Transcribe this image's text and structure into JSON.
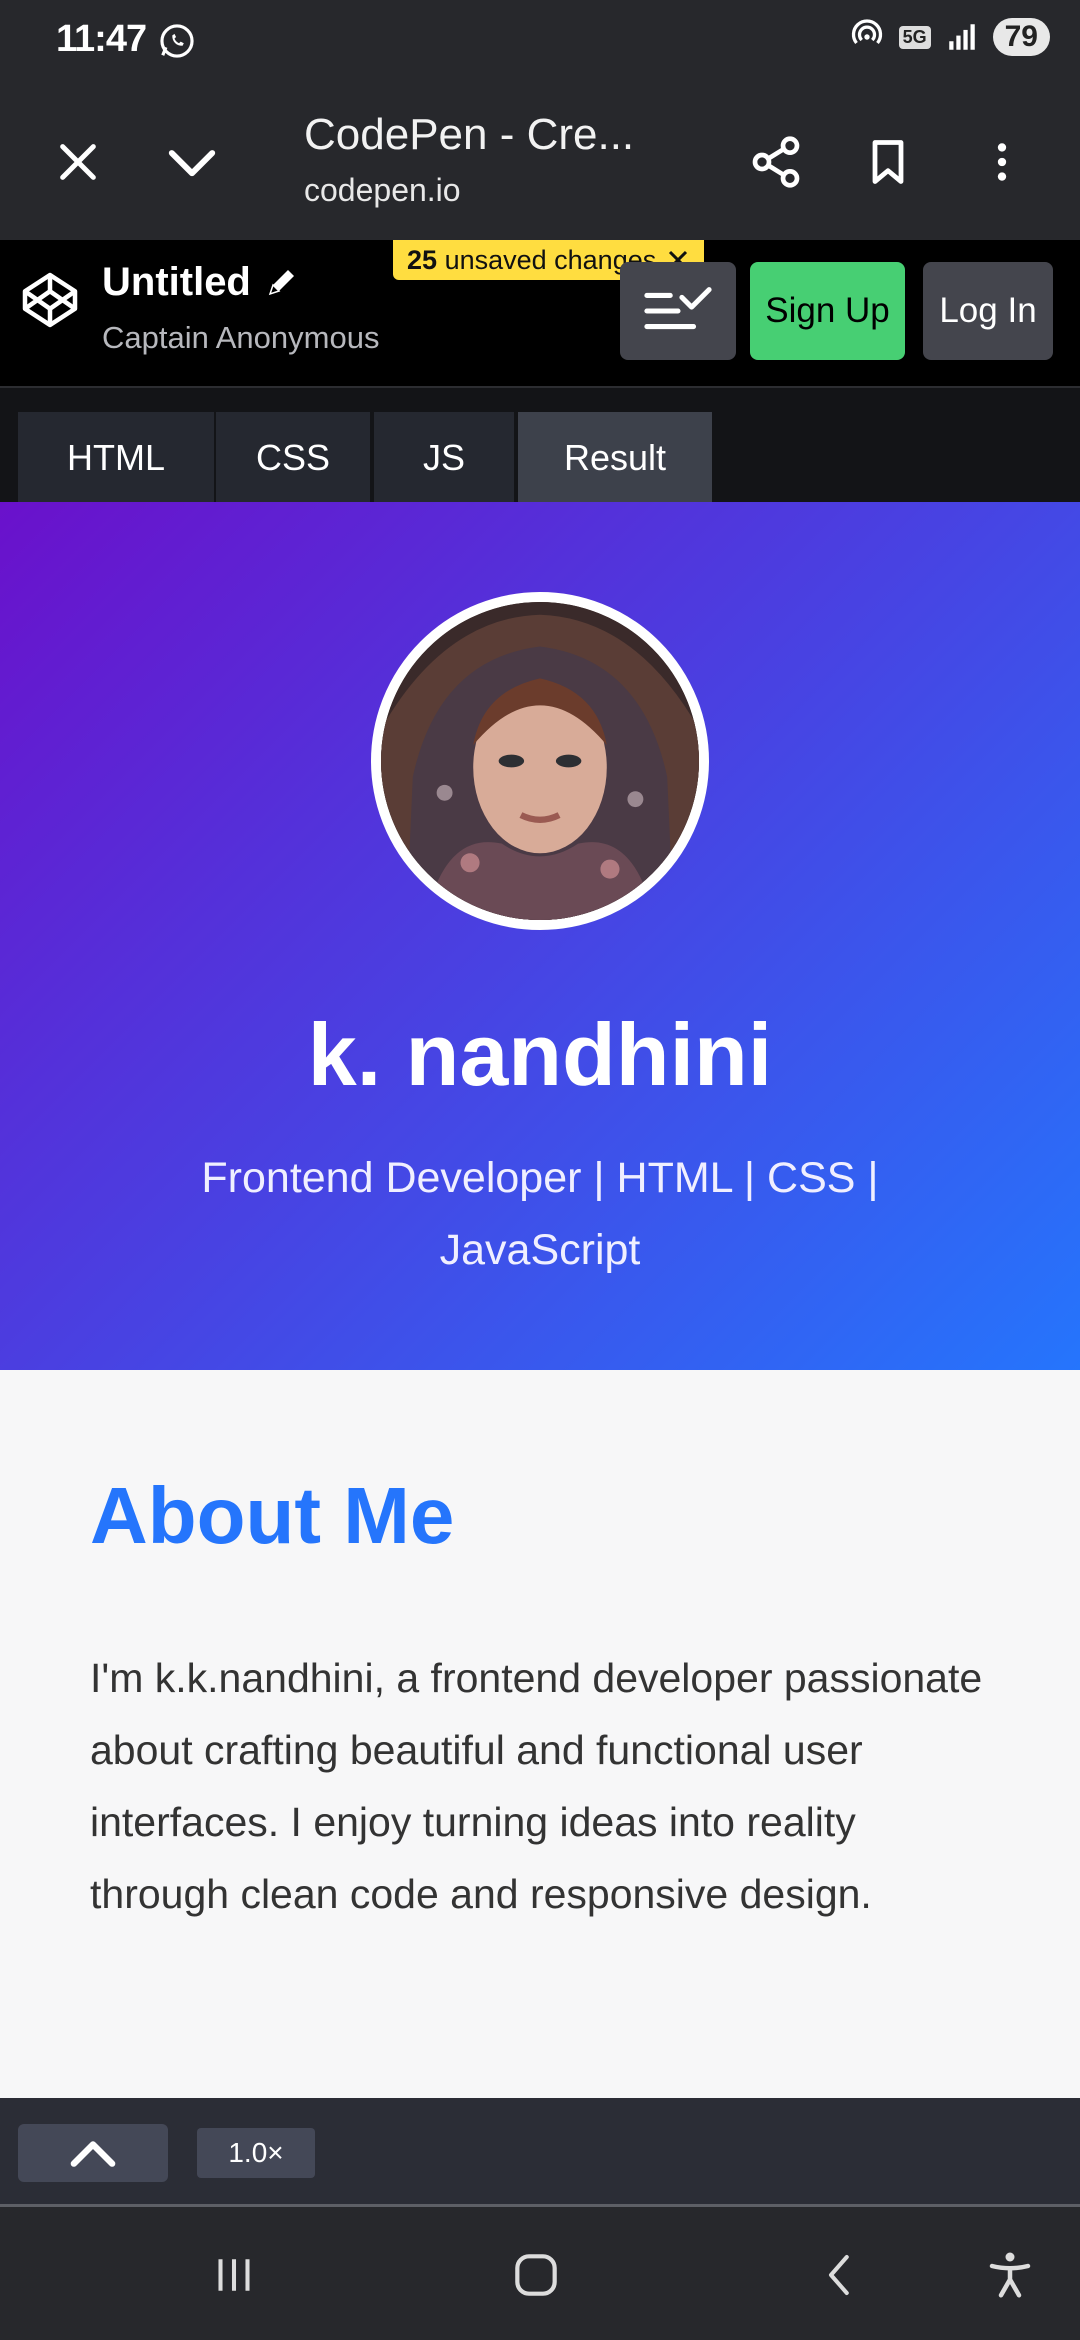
{
  "status_bar": {
    "time": "11:47",
    "network": "5G",
    "battery": "79"
  },
  "browser": {
    "page_title": "CodePen - Cre...",
    "url": "codepen.io",
    "icons": [
      "close-icon",
      "chevron-down-icon",
      "share-icon",
      "bookmark-icon",
      "more-vert-icon"
    ]
  },
  "codepen": {
    "pen_title": "Untitled",
    "author": "Captain Anonymous",
    "unsaved_count": "25",
    "unsaved_label": "unsaved changes",
    "signup_label": "Sign Up",
    "login_label": "Log In",
    "tabs": [
      "HTML",
      "CSS",
      "JS",
      "Result"
    ],
    "active_tab": "Result"
  },
  "result": {
    "name": "k. nandhini",
    "subtitle": "Frontend Developer | HTML | CSS | JavaScript",
    "about_heading": "About Me",
    "about_text": "I'm k.k.nandhini, a frontend developer passionate about crafting beautiful and functional user interfaces. I enjoy turning ideas into reality through clean code and responsive design.",
    "colors": {
      "gradient_start": "#6a11cb",
      "gradient_end": "#2575fc",
      "heading_blue": "#2575fc"
    }
  },
  "editor_bar": {
    "zoom": "1.0×"
  },
  "system_nav": {
    "icons": [
      "recents-icon",
      "home-icon",
      "back-icon",
      "accessibility-icon"
    ]
  }
}
